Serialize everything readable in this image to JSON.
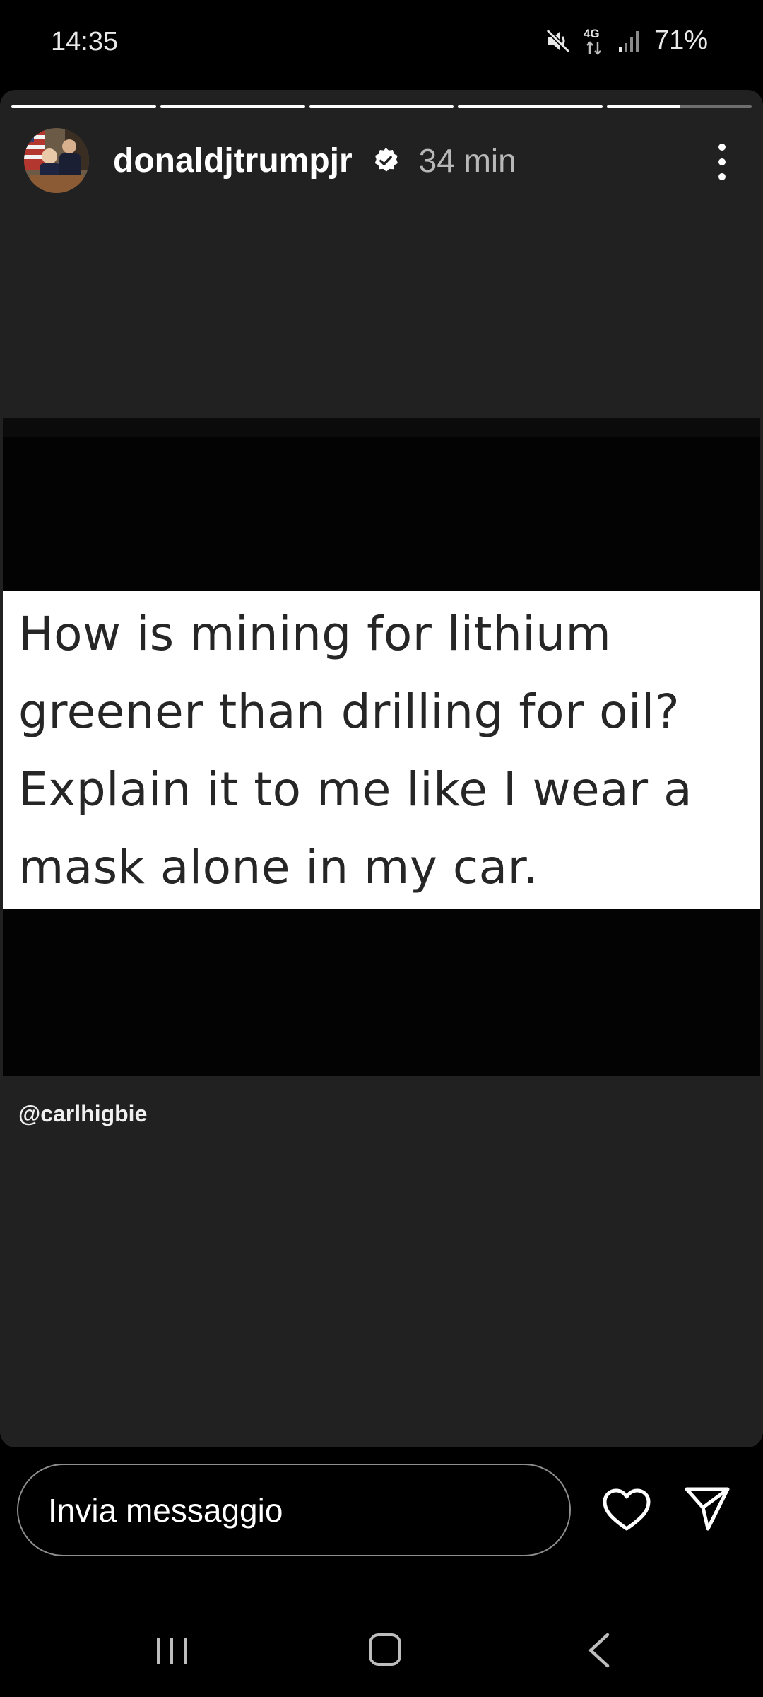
{
  "status_bar": {
    "time": "14:35",
    "network": "4G",
    "battery": "71%",
    "icons": [
      "mute-icon",
      "network-4g-icon",
      "signal-icon"
    ]
  },
  "story": {
    "progress": [
      1,
      1,
      1,
      1,
      0.5
    ],
    "username": "donaldjtrumpjr",
    "verified": true,
    "time_ago": "34 min",
    "tweet_text": "How is mining for lithium\ngreener than drilling for oil?\nExplain it to me like I wear a\nmask alone in my car.",
    "mention": "@carlhigbie"
  },
  "reply": {
    "placeholder": "Invia messaggio",
    "like_icon": "heart-icon",
    "send_icon": "paper-plane-icon"
  },
  "navbar": {
    "icons": [
      "recent-apps-icon",
      "home-icon",
      "back-icon"
    ]
  },
  "colors": {
    "background": "#000000",
    "story_bg": "#212121",
    "card_text": "#262626",
    "secondary_text": "#b8b8b8"
  }
}
